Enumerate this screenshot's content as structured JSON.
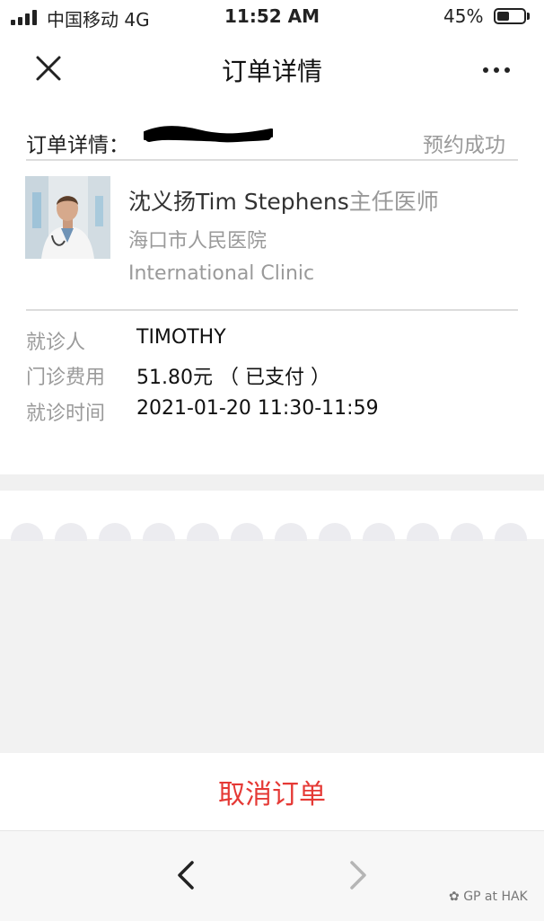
{
  "status_bar": {
    "carrier": "中国移动  4G",
    "time": "11:52 AM",
    "battery_percent": "45%",
    "battery_level": 0.45,
    "signal_icon": "signal-bars-icon",
    "battery_icon": "battery-icon"
  },
  "nav": {
    "title": "订单详情",
    "close_icon": "close-icon",
    "more_icon": "more-dots-icon"
  },
  "order": {
    "label": "订单详情：",
    "number_redacted": true,
    "status": "预约成功"
  },
  "doctor": {
    "name": "沈义扬Tim Stephens",
    "title": "主任医师",
    "hospital": "海口市人民医院",
    "clinic": "International Clinic"
  },
  "details": [
    {
      "label": "就诊人",
      "value": "TIMOTHY"
    },
    {
      "label": "门诊费用",
      "value": "51.80元 （ 已支付 ）"
    },
    {
      "label": "就诊时间",
      "value": "2021-01-20 11:30-11:59"
    }
  ],
  "cancel_label": "取消订单",
  "toolbar": {
    "back_icon": "chevron-left-icon",
    "forward_icon": "chevron-right-icon"
  },
  "watermark": "GP at HAK",
  "colors": {
    "cancel": "#e53935",
    "muted_text": "#9a9a9a",
    "divider": "#dcdcdc",
    "grey_bg": "#f2f2f2"
  }
}
